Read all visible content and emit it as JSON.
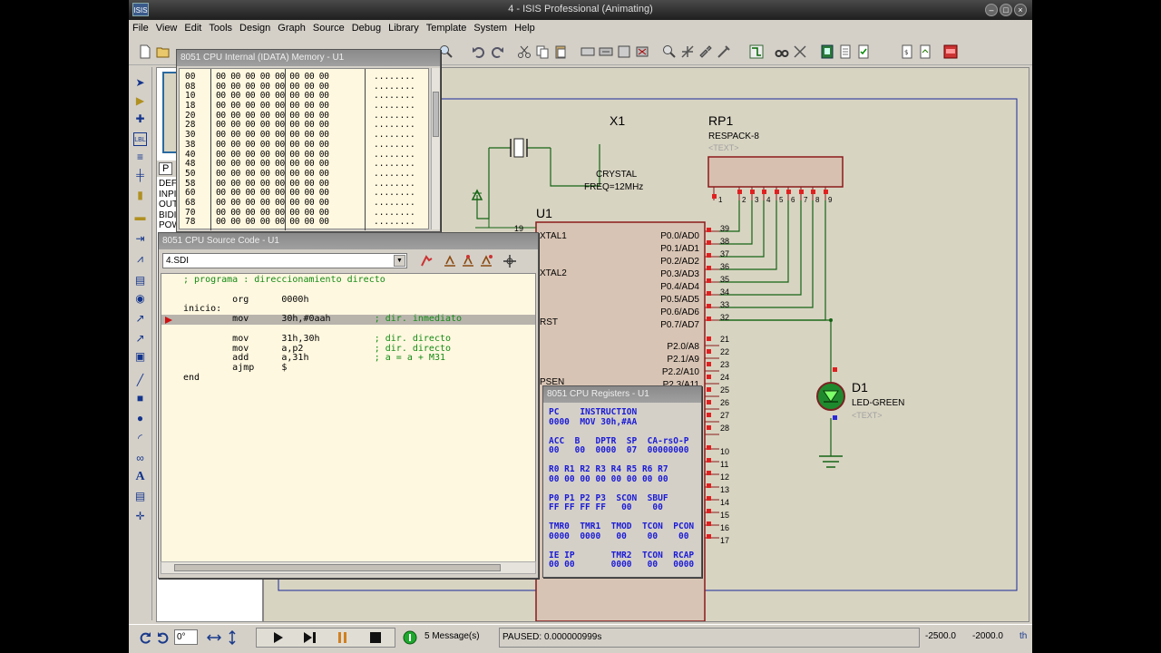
{
  "title": "4 - ISIS Professional (Animating)",
  "app_icon": "ISIS",
  "menu": [
    "File",
    "View",
    "Edit",
    "Tools",
    "Design",
    "Graph",
    "Source",
    "Debug",
    "Library",
    "Template",
    "System",
    "Help"
  ],
  "side_panel": {
    "tab": "P",
    "items": [
      "DEF",
      "INPI",
      "OUT",
      "BIDI",
      "POW"
    ]
  },
  "schematic": {
    "x1_ref": "X1",
    "x1_value": "CRYSTAL",
    "x1_freq": "FREQ=12MHz",
    "rp1_ref": "RP1",
    "rp1_value": "RESPACK-8",
    "rp1_text": "<TEXT>",
    "rp1_pins": [
      "1",
      "2",
      "3",
      "4",
      "5",
      "6",
      "7",
      "8",
      "9"
    ],
    "u1_ref": "U1",
    "u1_pin19": "19",
    "u1_left_pins": [
      "XTAL1",
      "XTAL2",
      "RST",
      "PSEN"
    ],
    "p0_pins": [
      {
        "name": "P0.0/AD0",
        "num": "39"
      },
      {
        "name": "P0.1/AD1",
        "num": "38"
      },
      {
        "name": "P0.2/AD2",
        "num": "37"
      },
      {
        "name": "P0.3/AD3",
        "num": "36"
      },
      {
        "name": "P0.4/AD4",
        "num": "35"
      },
      {
        "name": "P0.5/AD5",
        "num": "34"
      },
      {
        "name": "P0.6/AD6",
        "num": "33"
      },
      {
        "name": "P0.7/AD7",
        "num": "32"
      }
    ],
    "p2_pins": [
      {
        "name": "P2.0/A8",
        "num": "21"
      },
      {
        "name": "P2.1/A9",
        "num": "22"
      },
      {
        "name": "P2.2/A10",
        "num": "23"
      },
      {
        "name": "P2.3/A11",
        "num": "24"
      }
    ],
    "extra_pins": [
      "25",
      "26",
      "27",
      "28",
      "10",
      "11",
      "12",
      "13",
      "14",
      "15",
      "16",
      "17"
    ],
    "d1_ref": "D1",
    "d1_value": "LED-GREEN",
    "d1_text": "<TEXT>"
  },
  "memory_window": {
    "title": "8051 CPU Internal (IDATA) Memory - U1",
    "rows": [
      {
        "addr": "00",
        "hex": "00 00 00 00 00 00 00 00",
        "ascii": "........"
      },
      {
        "addr": "08",
        "hex": "00 00 00 00 00 00 00 00",
        "ascii": "........"
      },
      {
        "addr": "10",
        "hex": "00 00 00 00 00 00 00 00",
        "ascii": "........"
      },
      {
        "addr": "18",
        "hex": "00 00 00 00 00 00 00 00",
        "ascii": "........"
      },
      {
        "addr": "20",
        "hex": "00 00 00 00 00 00 00 00",
        "ascii": "........"
      },
      {
        "addr": "28",
        "hex": "00 00 00 00 00 00 00 00",
        "ascii": "........"
      },
      {
        "addr": "30",
        "hex": "00 00 00 00 00 00 00 00",
        "ascii": "........"
      },
      {
        "addr": "38",
        "hex": "00 00 00 00 00 00 00 00",
        "ascii": "........"
      },
      {
        "addr": "40",
        "hex": "00 00 00 00 00 00 00 00",
        "ascii": "........"
      },
      {
        "addr": "48",
        "hex": "00 00 00 00 00 00 00 00",
        "ascii": "........"
      },
      {
        "addr": "50",
        "hex": "00 00 00 00 00 00 00 00",
        "ascii": "........"
      },
      {
        "addr": "58",
        "hex": "00 00 00 00 00 00 00 00",
        "ascii": "........"
      },
      {
        "addr": "60",
        "hex": "00 00 00 00 00 00 00 00",
        "ascii": "........"
      },
      {
        "addr": "68",
        "hex": "00 00 00 00 00 00 00 00",
        "ascii": "........"
      },
      {
        "addr": "70",
        "hex": "00 00 00 00 00 00 00 00",
        "ascii": "........"
      },
      {
        "addr": "78",
        "hex": "00 00 00 00 00 00 00 00",
        "ascii": "........"
      }
    ]
  },
  "source_window": {
    "title": "8051 CPU Source Code - U1",
    "file": "4.SDI",
    "lines": [
      "; programa : direccionamiento directo",
      "",
      "         org      0000h",
      "inicio:",
      "         mov      30h,#0aah        ; dir. inmediato",
      "",
      "         mov      31h,30h          ; dir. directo",
      "         mov      a,p2             ; dir. directo",
      "         add      a,31h            ; a = a + M31",
      "         ajmp     $",
      "end"
    ]
  },
  "registers_window": {
    "title": "8051 CPU Registers - U1",
    "lines": [
      "PC    INSTRUCTION",
      "0000  MOV 30h,#AA",
      "",
      "ACC  B   DPTR  SP  CA-rsO-P",
      "00   00  0000  07  00000000",
      "",
      "R0 R1 R2 R3 R4 R5 R6 R7",
      "00 00 00 00 00 00 00 00",
      "",
      "P0 P1 P2 P3  SCON  SBUF",
      "FF FF FF FF   00    00",
      "",
      "TMR0  TMR1  TMOD  TCON  PCON",
      "0000  0000   00    00    00",
      "",
      "IE IP       TMR2  TCON  RCAP",
      "00 00       0000   00   0000"
    ]
  },
  "status": {
    "rotation": "0°",
    "messages": "5 Message(s)",
    "sim_status": "PAUSED: 0.000000999s",
    "coord_x": "-2500.0",
    "coord_y": "-2000.0",
    "units": "th"
  }
}
